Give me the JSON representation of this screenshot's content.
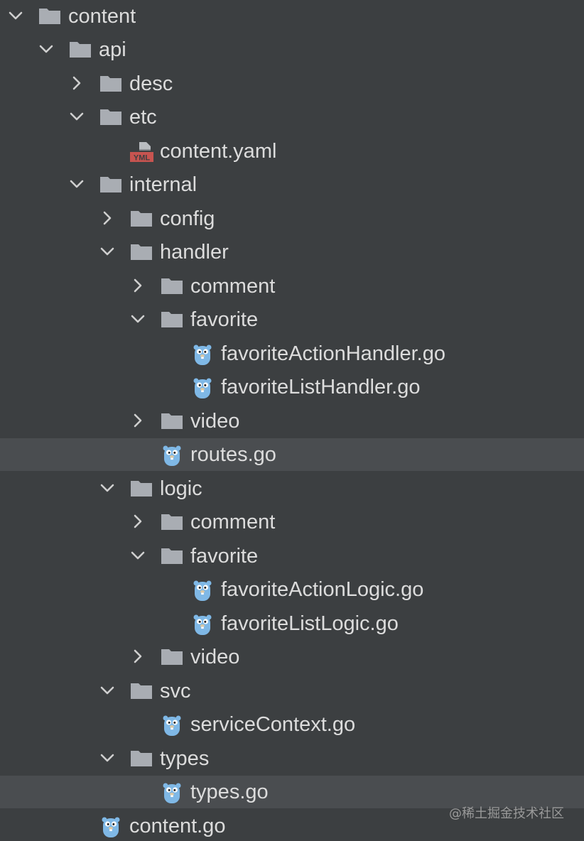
{
  "tree": {
    "rows": [
      {
        "label": "content",
        "kind": "folder",
        "state": "expanded"
      },
      {
        "label": "api",
        "kind": "folder",
        "state": "expanded"
      },
      {
        "label": "desc",
        "kind": "folder",
        "state": "collapsed"
      },
      {
        "label": "etc",
        "kind": "folder",
        "state": "expanded"
      },
      {
        "label": "content.yaml",
        "kind": "yaml",
        "state": "leaf"
      },
      {
        "label": "internal",
        "kind": "folder",
        "state": "expanded"
      },
      {
        "label": "config",
        "kind": "folder",
        "state": "collapsed"
      },
      {
        "label": "handler",
        "kind": "folder",
        "state": "expanded"
      },
      {
        "label": "comment",
        "kind": "folder",
        "state": "collapsed"
      },
      {
        "label": "favorite",
        "kind": "folder",
        "state": "expanded"
      },
      {
        "label": "favoriteActionHandler.go",
        "kind": "go",
        "state": "leaf"
      },
      {
        "label": "favoriteListHandler.go",
        "kind": "go",
        "state": "leaf"
      },
      {
        "label": "video",
        "kind": "folder",
        "state": "collapsed"
      },
      {
        "label": "routes.go",
        "kind": "go",
        "state": "leaf",
        "highlighted": true
      },
      {
        "label": "logic",
        "kind": "folder",
        "state": "expanded"
      },
      {
        "label": "comment",
        "kind": "folder",
        "state": "collapsed"
      },
      {
        "label": "favorite",
        "kind": "folder",
        "state": "expanded"
      },
      {
        "label": "favoriteActionLogic.go",
        "kind": "go",
        "state": "leaf"
      },
      {
        "label": "favoriteListLogic.go",
        "kind": "go",
        "state": "leaf"
      },
      {
        "label": "video",
        "kind": "folder",
        "state": "collapsed"
      },
      {
        "label": "svc",
        "kind": "folder",
        "state": "expanded"
      },
      {
        "label": "serviceContext.go",
        "kind": "go",
        "state": "leaf"
      },
      {
        "label": "types",
        "kind": "folder",
        "state": "expanded"
      },
      {
        "label": "types.go",
        "kind": "go",
        "state": "leaf",
        "highlighted": true
      },
      {
        "label": "content.go",
        "kind": "go",
        "state": "leaf"
      }
    ]
  },
  "yaml_badge": "YML",
  "watermark": "@稀土掘金技术社区",
  "colors": {
    "background": "#3c3f41",
    "highlight": "#4a4d50",
    "text": "#dcdcdc",
    "folder": "#a9adb3",
    "go_gopher": "#7fb8e6",
    "yaml_red": "#c75450"
  }
}
